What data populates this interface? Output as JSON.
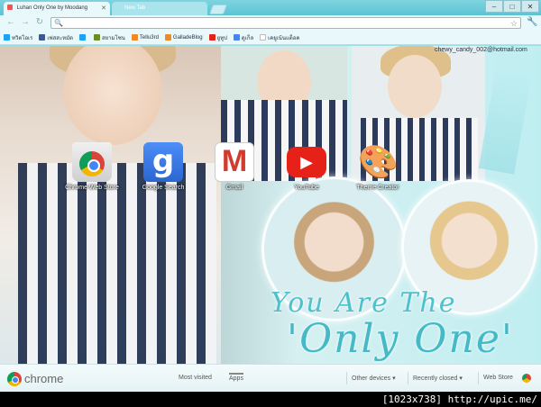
{
  "window": {
    "tabs": [
      {
        "label": "Luhan Only One by Moodang",
        "active": true
      },
      {
        "label": "New Tab",
        "active": false
      }
    ],
    "controls": {
      "minimize": "–",
      "maximize": "□",
      "close": "✕"
    }
  },
  "toolbar": {
    "back": "←",
    "forward": "→",
    "reload": "↻",
    "omnibox_value": "",
    "search_icon": "🔍",
    "star_icon": "☆",
    "wrench_icon": "🔧"
  },
  "bookmarks": [
    {
      "label": "ทวิตโอเร",
      "icon_color": "#1da1f2"
    },
    {
      "label": "เฟสสะหมัด",
      "icon_color": "#3b5998"
    },
    {
      "label": "",
      "icon_color": "#1da1f2"
    },
    {
      "label": "สยามโซน",
      "icon_color": "#6b8e23"
    },
    {
      "label": "Tellu3rd",
      "icon_color": "#f08a24"
    },
    {
      "label": "GalladeBlog",
      "icon_color": "#f08a24"
    },
    {
      "label": "ยูทูป",
      "icon_color": "#e62117"
    },
    {
      "label": "ดูเก็ล",
      "icon_color": "#4285f4"
    },
    {
      "label": "เคยูเน้นแด็อค",
      "icon_color": "#cccccc"
    }
  ],
  "content": {
    "email": "chewy_candy_002@hotmail.com",
    "slogan_line1": "You Are The",
    "slogan_line2": "'Only One'"
  },
  "apps": [
    {
      "label": "Chrome Web Store",
      "icon": "webstore-icon"
    },
    {
      "label": "Google Search",
      "icon": "google-icon",
      "glyph": "g"
    },
    {
      "label": "Gmail",
      "icon": "gmail-icon",
      "glyph": "M"
    },
    {
      "label": "YouTube",
      "icon": "youtube-icon",
      "glyph": "▶"
    },
    {
      "label": "Theme Creator",
      "icon": "palette-icon",
      "glyph": "🎨"
    }
  ],
  "footer": {
    "brand": "chrome",
    "tabs": [
      {
        "label": "Most visited",
        "active": false
      },
      {
        "label": "Apps",
        "active": true
      }
    ],
    "menus": [
      "Other devices ▾",
      "Recently closed ▾",
      "Web Store"
    ]
  },
  "caption": "[1023x738] http://upic.me/"
}
